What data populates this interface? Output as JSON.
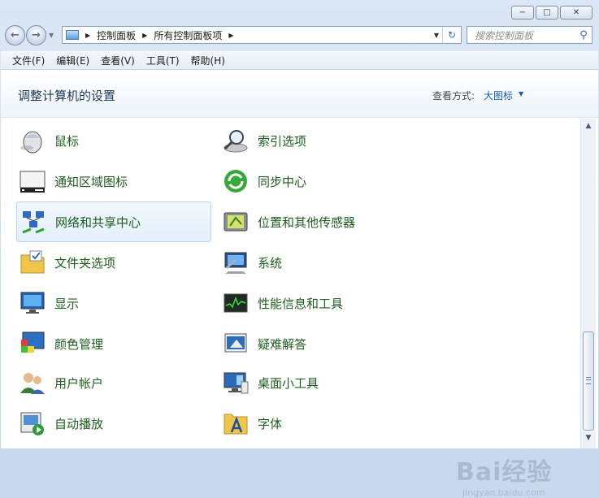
{
  "window": {
    "minimize": "−",
    "maximize": "□",
    "close": "✕"
  },
  "address": {
    "crumbs": [
      "控制面板",
      "所有控制面板项"
    ]
  },
  "search": {
    "placeholder": "搜索控制面板"
  },
  "menu": [
    "文件(F)",
    "编辑(E)",
    "查看(V)",
    "工具(T)",
    "帮助(H)"
  ],
  "header": {
    "title": "调整计算机的设置",
    "view_by_label": "查看方式:",
    "view_by_value": "大图标"
  },
  "items": {
    "left": [
      {
        "label": "鼠标",
        "icon": "mouse-icon"
      },
      {
        "label": "通知区域图标",
        "icon": "notification-area-icon"
      },
      {
        "label": "网络和共享中心",
        "icon": "network-sharing-icon",
        "selected": true
      },
      {
        "label": "文件夹选项",
        "icon": "folder-options-icon"
      },
      {
        "label": "显示",
        "icon": "display-icon"
      },
      {
        "label": "颜色管理",
        "icon": "color-management-icon"
      },
      {
        "label": "用户帐户",
        "icon": "user-accounts-icon"
      },
      {
        "label": "自动播放",
        "icon": "autoplay-icon"
      }
    ],
    "right": [
      {
        "label": "索引选项",
        "icon": "indexing-options-icon"
      },
      {
        "label": "同步中心",
        "icon": "sync-center-icon"
      },
      {
        "label": "位置和其他传感器",
        "icon": "location-sensors-icon"
      },
      {
        "label": "系统",
        "icon": "system-icon"
      },
      {
        "label": "性能信息和工具",
        "icon": "performance-icon"
      },
      {
        "label": "疑难解答",
        "icon": "troubleshooting-icon"
      },
      {
        "label": "桌面小工具",
        "icon": "desktop-gadgets-icon"
      },
      {
        "label": "字体",
        "icon": "fonts-icon"
      }
    ]
  },
  "watermark": {
    "main": "Bai经验",
    "sub": "jingyan.baidu.com"
  }
}
